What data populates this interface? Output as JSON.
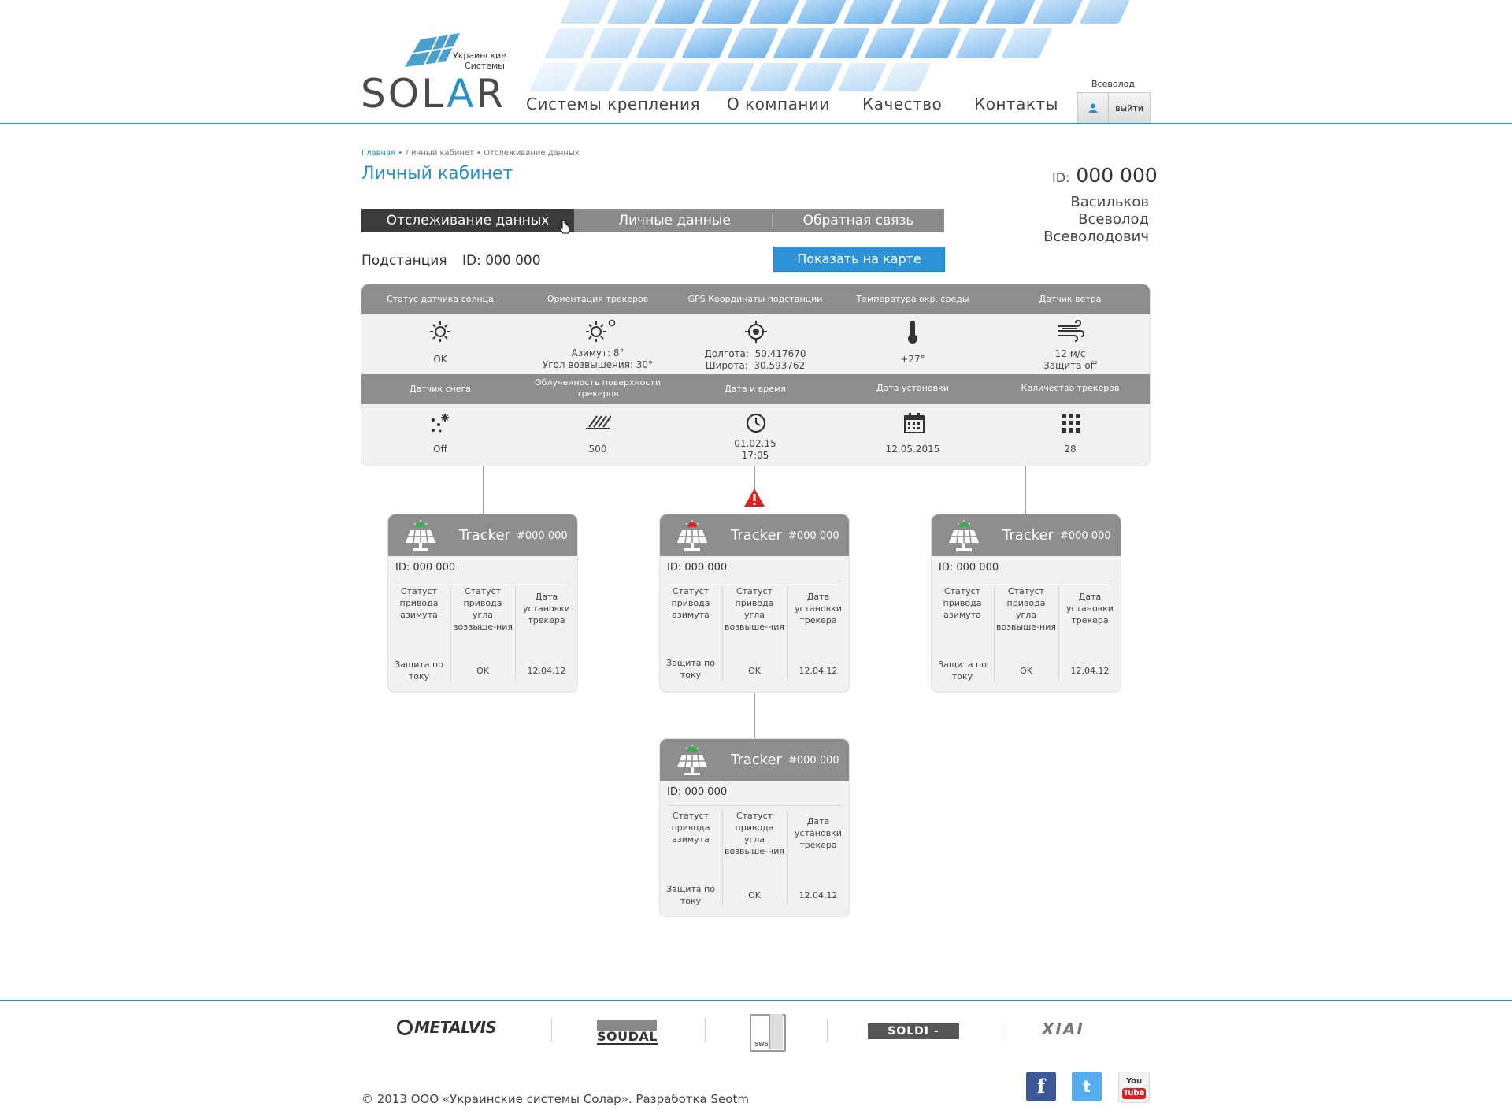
{
  "header": {
    "logo_subtitle_1": "Украинские",
    "logo_subtitle_2": "Системы",
    "logo_word_a": "SOL",
    "logo_word_b": "A",
    "logo_word_c": "R",
    "nav": [
      "Системы крепления",
      "О компании",
      "Качество",
      "Контакты"
    ],
    "user_name": "Всеволод",
    "logout_label": "выйти"
  },
  "breadcrumb": {
    "home": "Главная",
    "rest": " • Личный кабинет • Отслеживание данных"
  },
  "page_title": "Личный кабинет",
  "account": {
    "id_label": "ID:",
    "id_value": "000 000",
    "surname": "Васильков",
    "name": "Всеволод",
    "patronymic": "Всеволодович"
  },
  "tabs": [
    "Отслеживание данных",
    "Личные данные",
    "Обратная связь"
  ],
  "substation": {
    "label": "Подстанция",
    "id_text": "ID: 000 000",
    "map_button": "Показать на карте"
  },
  "sensors_row1": {
    "headers": [
      "Статус датчика солнца",
      "Ориентация трекеров",
      "GPS Координаты подстанции",
      "Температура окр. среды",
      "Датчик ветра"
    ],
    "sun_status": "OK",
    "azimuth": "Азимут: 8°",
    "elevation": "Угол возвышения: 30°",
    "lon_label": "Долгота:",
    "lon_value": "50.417670",
    "lat_label": "Широта:",
    "lat_value": "30.593762",
    "temperature": "+27°",
    "wind_speed": "12 м/с",
    "wind_protect": "Защита off"
  },
  "sensors_row2": {
    "headers": [
      "Датчик снега",
      "Облученность поверхности трекеров",
      "Дата и время",
      "Дата установки",
      "Количество трекеров"
    ],
    "snow": "Off",
    "irradiance": "500",
    "date": "01.02.15",
    "time": "17:05",
    "install_date": "12.05.2015",
    "tracker_count": "28"
  },
  "trackers": [
    {
      "title": "Tracker",
      "num": "#000 000",
      "id": "ID: 000 000",
      "col1": "Статуст привода азимута",
      "col2": "Статуст привода угла возвыше-ния",
      "col3": "Дата установки трекера",
      "val1": "Защита по току",
      "val2": "OK",
      "val3": "12.04.12",
      "status_color": "#2db34a"
    },
    {
      "title": "Tracker",
      "num": "#000 000",
      "id": "ID: 000 000",
      "col1": "Статуст привода азимута",
      "col2": "Статуст привода угла возвыше-ния",
      "col3": "Дата установки трекера",
      "val1": "Защита по току",
      "val2": "OK",
      "val3": "12.04.12",
      "status_color": "#e02020"
    },
    {
      "title": "Tracker",
      "num": "#000 000",
      "id": "ID: 000 000",
      "col1": "Статуст привода азимута",
      "col2": "Статуст привода угла возвыше-ния",
      "col3": "Дата установки трекера",
      "val1": "Защита по току",
      "val2": "OK",
      "val3": "12.04.12",
      "status_color": "#2db34a"
    },
    {
      "title": "Tracker",
      "num": "#000 000",
      "id": "ID: 000 000",
      "col1": "Статуст привода азимута",
      "col2": "Статуст привода угла возвыше-ния",
      "col3": "Дата установки трекера",
      "val1": "Защита по току",
      "val2": "OK",
      "val3": "12.04.12",
      "status_color": "#2db34a"
    }
  ],
  "footer": {
    "brands": [
      "METALVIS",
      "SOUDAL",
      "SWS",
      "SOLDI - DELTA",
      "XIAI"
    ],
    "copyright": "© 2013 ООО «Украинские системы Солар». Разработка Seotm",
    "social": [
      "facebook-icon",
      "twitter-icon",
      "youtube-icon"
    ]
  },
  "colors": {
    "accent": "#2a8fc4",
    "button": "#2d93d6",
    "header_gray": "#8e8e8e",
    "tab_active": "#3b3b3b",
    "warning": "#e02020"
  }
}
